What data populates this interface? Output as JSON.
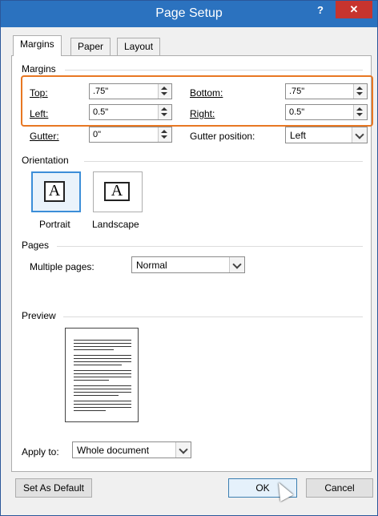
{
  "window": {
    "title": "Page Setup",
    "help": "?",
    "close": "✕",
    "colors": {
      "titlebar": "#2b72bf",
      "close": "#c7342e",
      "highlight": "#e87722"
    }
  },
  "tabs": [
    {
      "label": "Margins",
      "active": true
    },
    {
      "label": "Paper",
      "active": false
    },
    {
      "label": "Layout",
      "active": false
    }
  ],
  "margins": {
    "section_title": "Margins",
    "top": {
      "label": "Top:",
      "value": ".75\""
    },
    "bottom": {
      "label": "Bottom:",
      "value": ".75\""
    },
    "left": {
      "label": "Left:",
      "value": "0.5\""
    },
    "right": {
      "label": "Right:",
      "value": "0.5\""
    },
    "gutter": {
      "label": "Gutter:",
      "value": "0\""
    },
    "gutter_position": {
      "label": "Gutter position:",
      "value": "Left"
    }
  },
  "orientation": {
    "section_title": "Orientation",
    "portrait": {
      "label": "Portrait",
      "glyph": "A",
      "selected": true
    },
    "landscape": {
      "label": "Landscape",
      "glyph": "A",
      "selected": false
    }
  },
  "pages": {
    "section_title": "Pages",
    "multiple_pages": {
      "label": "Multiple pages:",
      "value": "Normal"
    }
  },
  "preview": {
    "section_title": "Preview"
  },
  "apply_to": {
    "label": "Apply to:",
    "value": "Whole document"
  },
  "buttons": {
    "set_default": "Set As Default",
    "ok": "OK",
    "cancel": "Cancel"
  }
}
